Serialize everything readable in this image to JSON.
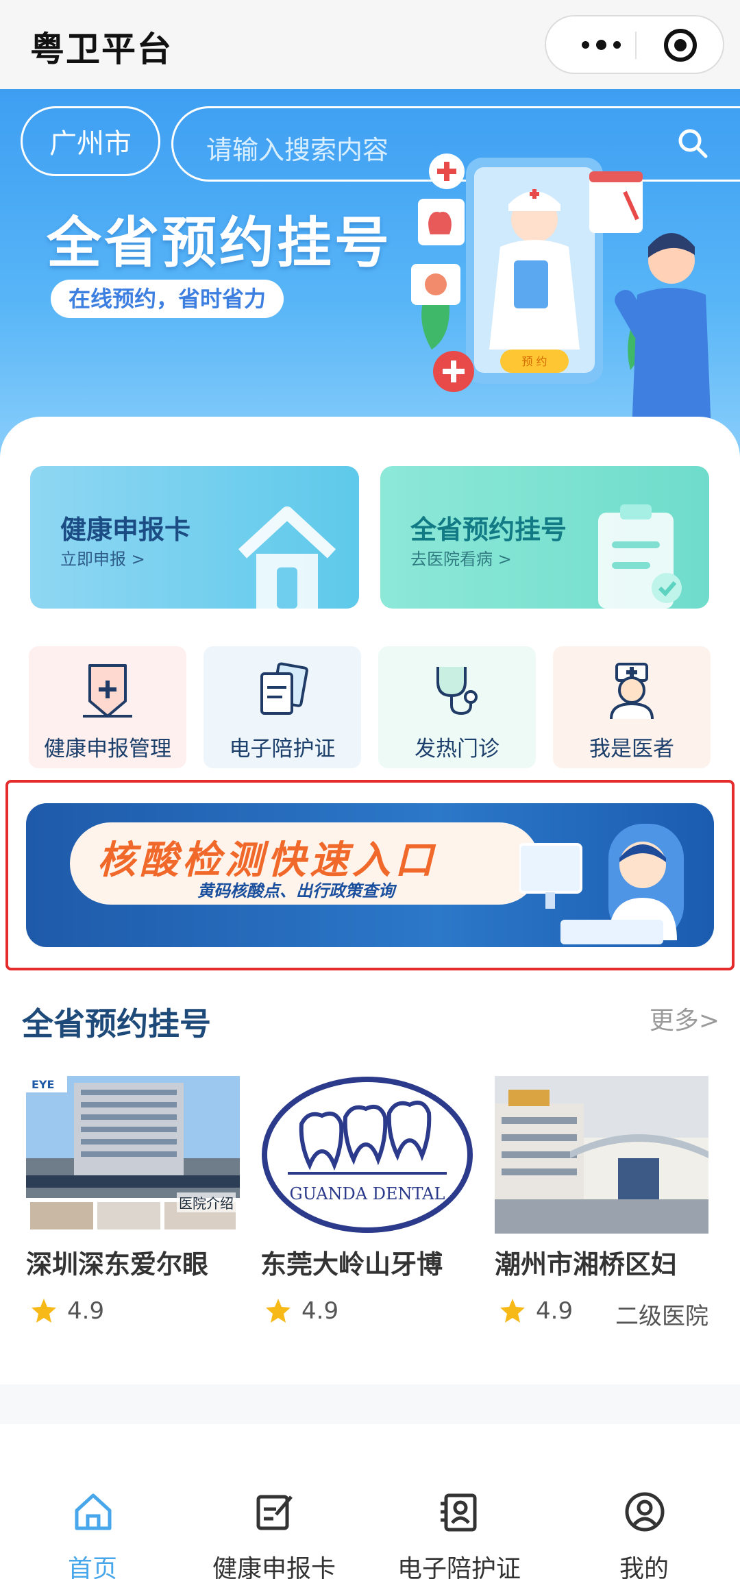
{
  "header": {
    "app_title": "粤卫平台"
  },
  "banner": {
    "city": "广州市",
    "search_placeholder": "请输入搜索内容",
    "title": "全省预约挂号",
    "subtitle": "在线预约，省时省力",
    "illustration_button": "预 约"
  },
  "feature_cards": [
    {
      "title": "健康申报卡",
      "subtitle": "立即申报 >"
    },
    {
      "title": "全省预约挂号",
      "subtitle": "去医院看病 >"
    }
  ],
  "quick_links": [
    {
      "label": "健康申报管理",
      "icon": "shield-plus-icon"
    },
    {
      "label": "电子陪护证",
      "icon": "documents-icon"
    },
    {
      "label": "发热门诊",
      "icon": "stethoscope-icon"
    },
    {
      "label": "我是医者",
      "icon": "doctor-icon"
    }
  ],
  "covid_banner": {
    "title": "核酸检测快速入口",
    "subtitle": "黄码核酸点、出行政策查询"
  },
  "section": {
    "title": "全省预约挂号",
    "more": "更多>"
  },
  "hospitals": [
    {
      "name": "深圳深东爱尔眼",
      "rating": "4.9",
      "level": "",
      "image_caption": "医院介绍"
    },
    {
      "name": "东莞大岭山牙博",
      "rating": "4.9",
      "level": "",
      "logo_text": "GUANDA DENTAL"
    },
    {
      "name": "潮州市湘桥区妇",
      "rating": "4.9",
      "level": "二级医院"
    }
  ],
  "tabbar": {
    "items": [
      {
        "label": "首页",
        "icon": "home-icon",
        "active": true
      },
      {
        "label": "健康申报卡",
        "icon": "edit-icon",
        "active": false
      },
      {
        "label": "电子陪护证",
        "icon": "id-card-icon",
        "active": false
      },
      {
        "label": "我的",
        "icon": "user-icon",
        "active": false
      }
    ]
  },
  "colors": {
    "accent": "#47a7ea",
    "banner_blue": "#3e9ef2",
    "highlight_red": "#e52b2b",
    "covid_orange": "#f0692a"
  }
}
